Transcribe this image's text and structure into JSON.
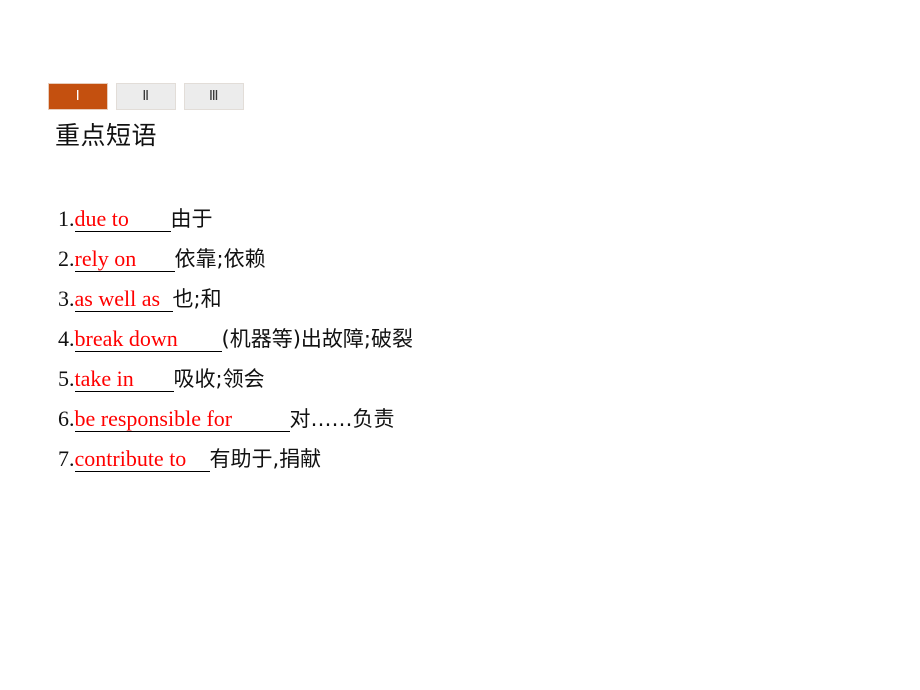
{
  "tabs": [
    {
      "label": "Ⅰ",
      "name": "tab-one",
      "active": true
    },
    {
      "label": "Ⅱ",
      "name": "tab-two",
      "active": false
    },
    {
      "label": "Ⅲ",
      "name": "tab-three",
      "active": false
    }
  ],
  "heading": "重点短语",
  "colors": {
    "active_tab_background": "#c4500f",
    "active_tab_text": "#ffffff",
    "inactive_tab_background": "#ececec",
    "answer_text": "#ff0000",
    "body_text": "#111111",
    "page_background": "#ffffff"
  },
  "phrases": [
    {
      "index": "1.",
      "answer": "due to",
      "meaning": "由于",
      "blank_width": 96
    },
    {
      "index": "2.",
      "answer": "rely on",
      "meaning": "依靠;依赖",
      "blank_width": 100
    },
    {
      "index": "3.",
      "answer": "as well as",
      "meaning": "也;和",
      "blank_width": 98
    },
    {
      "index": "4.",
      "answer": "break down",
      "meaning": "(机器等)出故障;破裂",
      "blank_width": 147
    },
    {
      "index": "5.",
      "answer": "take in",
      "meaning": "吸收;领会",
      "blank_width": 99
    },
    {
      "index": "6.",
      "answer": "be responsible for",
      "meaning": "对……负责",
      "blank_width": 215
    },
    {
      "index": "7.",
      "answer": "contribute to",
      "meaning": "有助于,捐献",
      "blank_width": 135
    }
  ]
}
